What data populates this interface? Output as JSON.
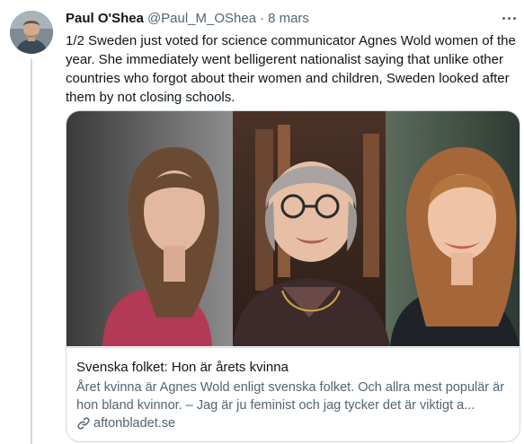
{
  "tweet": {
    "author_name": "Paul O'Shea",
    "author_handle": "@Paul_M_OShea",
    "separator": "·",
    "date": "8 mars",
    "text": "1/2 Sweden just voted for science communicator Agnes Wold women of the year. She immediately went belligerent nationalist saying that unlike other countries who forgot about their women and children, Sweden looked after them by not closing schools."
  },
  "card": {
    "title": "Svenska folket: Hon är årets kvinna",
    "description": "Året kvinna är Agnes Wold enligt svenska folket. Och allra mest populär är hon bland kvinnor. – Jag är ju feminist och jag tycker det är viktigt a...",
    "domain": "aftonbladet.se"
  },
  "icons": {
    "more": "more-horizontal-icon",
    "link": "link-icon"
  },
  "colors": {
    "text_primary": "#0f1419",
    "text_secondary": "#536471",
    "border": "#cfd9de"
  }
}
